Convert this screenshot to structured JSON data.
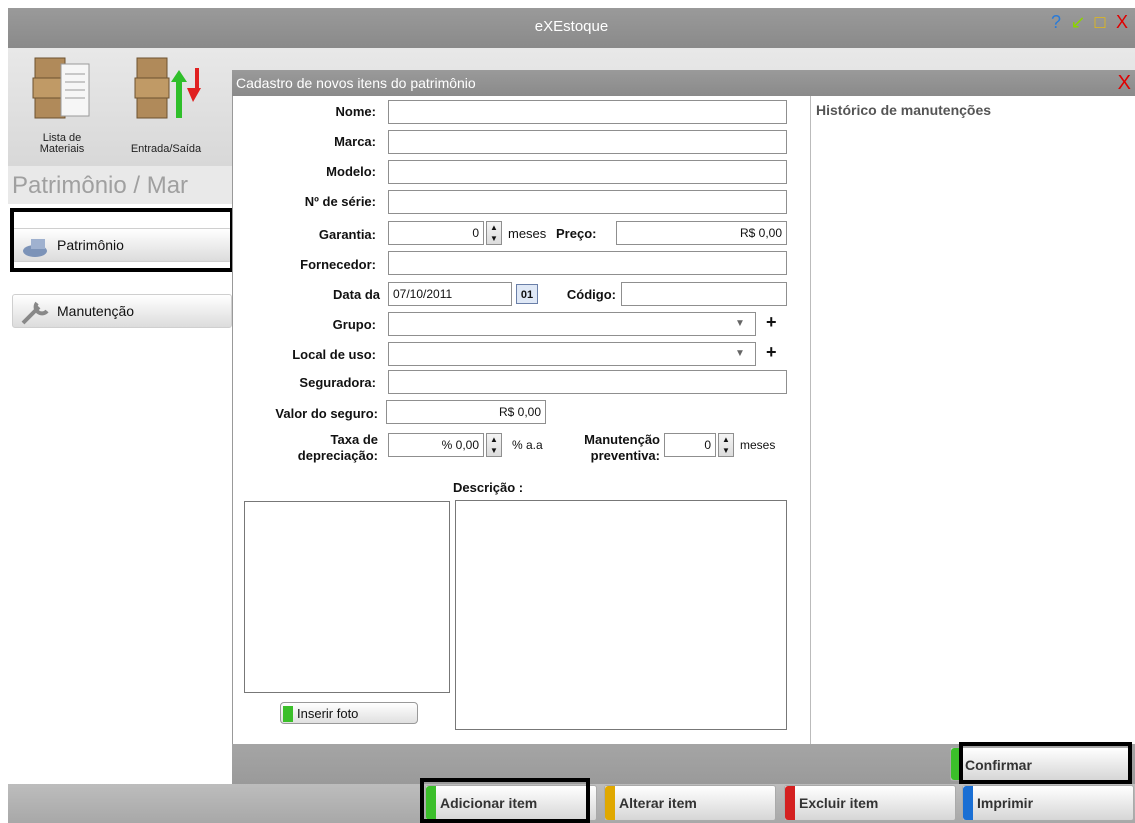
{
  "window": {
    "title": "eXEstoque",
    "controls": [
      "?",
      "↙",
      "□",
      "X"
    ]
  },
  "toolbar": {
    "items": [
      {
        "label_line1": "Lista de",
        "label_line2": "Materiais"
      },
      {
        "label_line1": "",
        "label_line2": "Entrada/Saída"
      }
    ]
  },
  "sidebar": {
    "heading": "Patrimônio / Mar",
    "items": [
      {
        "label": "Patrimônio"
      },
      {
        "label": "Manutenção"
      }
    ]
  },
  "dialog": {
    "title": "Cadastro de novos itens do patrimônio",
    "close": "X",
    "fields": {
      "nome": {
        "label": "Nome:",
        "value": ""
      },
      "marca": {
        "label": "Marca:",
        "value": ""
      },
      "modelo": {
        "label": "Modelo:",
        "value": ""
      },
      "serie": {
        "label": "Nº de série:",
        "value": ""
      },
      "garantia": {
        "label": "Garantia:",
        "value": "0",
        "unit": "meses"
      },
      "preco": {
        "label": "Preço:",
        "value": "R$ 0,00"
      },
      "fornecedor": {
        "label": "Fornecedor:",
        "value": ""
      },
      "data": {
        "label": "Data da",
        "value": "07/10/2011",
        "cal": "01"
      },
      "codigo": {
        "label": "Código:",
        "value": ""
      },
      "grupo": {
        "label": "Grupo:",
        "value": ""
      },
      "local": {
        "label": "Local de uso:",
        "value": ""
      },
      "seguradora": {
        "label": "Seguradora:",
        "value": ""
      },
      "valor_seguro": {
        "label": "Valor do seguro:",
        "value": "R$ 0,00"
      },
      "taxa": {
        "label1": "Taxa de",
        "label2": "depreciação:",
        "value": "% 0,00",
        "unit": "% a.a"
      },
      "manut": {
        "label1": "Manutenção",
        "label2": "preventiva:",
        "value": "0",
        "unit": "meses"
      }
    },
    "descricao_label": "Descrição :",
    "inserir_foto": "Inserir foto",
    "historico_label": "Histórico de manutenções",
    "confirm": "Confirmar"
  },
  "bottom": {
    "buttons": [
      {
        "label": "Adicionar item",
        "accent": "#3bbf2a"
      },
      {
        "label": "Alterar item",
        "accent": "#e0a800"
      },
      {
        "label": "Excluir item",
        "accent": "#d42020"
      },
      {
        "label": "Imprimir",
        "accent": "#1a6fd4"
      }
    ]
  },
  "colors": {
    "confirm_accent": "#3bbf2a",
    "close": "#e00000"
  }
}
